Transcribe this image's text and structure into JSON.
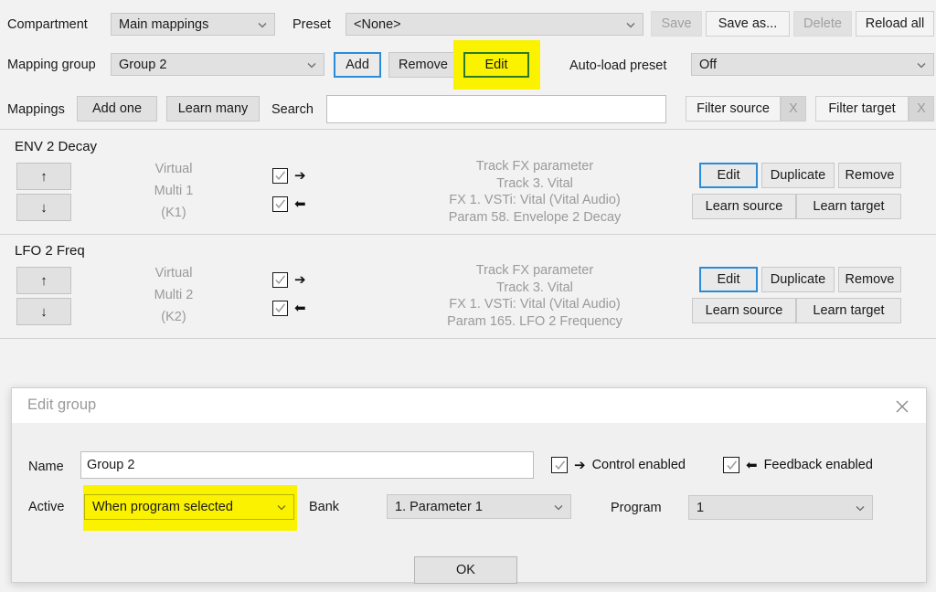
{
  "toolbar": {
    "compartment_label": "Compartment",
    "compartment_value": "Main mappings",
    "preset_label": "Preset",
    "preset_value": "<None>",
    "save_label": "Save",
    "save_as_label": "Save as...",
    "delete_label": "Delete",
    "reload_all_label": "Reload all",
    "mapping_group_label": "Mapping group",
    "mapping_group_value": "Group 2",
    "add_label": "Add",
    "remove_label": "Remove",
    "edit_label": "Edit",
    "autoload_label": "Auto-load preset",
    "autoload_value": "Off",
    "mappings_label": "Mappings",
    "add_one_label": "Add one",
    "learn_many_label": "Learn many",
    "search_label": "Search",
    "search_value": "",
    "search_placeholder": "",
    "filter_source_label": "Filter source",
    "filter_source_clear_label": "X",
    "filter_target_label": "Filter target",
    "filter_target_clear_label": "X"
  },
  "mappings": [
    {
      "title": "ENV 2 Decay",
      "up_glyph": "↑",
      "down_glyph": "↓",
      "source_lines": [
        "Virtual",
        "Multi 1",
        "(K1)"
      ],
      "control_enabled": true,
      "feedback_enabled": true,
      "control_arrow": "➔",
      "feedback_arrow": "⬅",
      "target_lines": [
        "Track FX parameter",
        "Track 3. Vital",
        "FX 1. VSTi: Vital (Vital Audio)",
        "Param 58. Envelope 2 Decay"
      ],
      "buttons": {
        "edit": "Edit",
        "duplicate": "Duplicate",
        "remove": "Remove",
        "learn_source": "Learn source",
        "learn_target": "Learn target"
      }
    },
    {
      "title": "LFO 2 Freq",
      "up_glyph": "↑",
      "down_glyph": "↓",
      "source_lines": [
        "Virtual",
        "Multi 2",
        "(K2)"
      ],
      "control_enabled": true,
      "feedback_enabled": true,
      "control_arrow": "➔",
      "feedback_arrow": "⬅",
      "target_lines": [
        "Track FX parameter",
        "Track 3. Vital",
        "FX 1. VSTi: Vital (Vital Audio)",
        "Param 165. LFO 2 Frequency"
      ],
      "buttons": {
        "edit": "Edit",
        "duplicate": "Duplicate",
        "remove": "Remove",
        "learn_source": "Learn source",
        "learn_target": "Learn target"
      }
    }
  ],
  "dialog": {
    "title": "Edit group",
    "close_icon": "close-icon",
    "name_label": "Name",
    "name_value": "Group 2",
    "active_label": "Active",
    "active_value": "When program selected",
    "bank_label": "Bank",
    "bank_value": "1. Parameter 1",
    "program_label": "Program",
    "program_value": "1",
    "control_enabled_label": "Control enabled",
    "control_enabled_arrow": "➔",
    "control_enabled_checked": true,
    "feedback_enabled_label": "Feedback enabled",
    "feedback_enabled_arrow": "⬅",
    "feedback_enabled_checked": true,
    "ok_label": "OK"
  },
  "colors": {
    "highlight_yellow": "#fbf200",
    "highlight_border_green": "#2a7a28",
    "focus_blue": "#2a8bd8",
    "window_bg": "#f2f2f2",
    "control_bg": "#e1e1e1",
    "muted_text": "#9a9a9a"
  }
}
